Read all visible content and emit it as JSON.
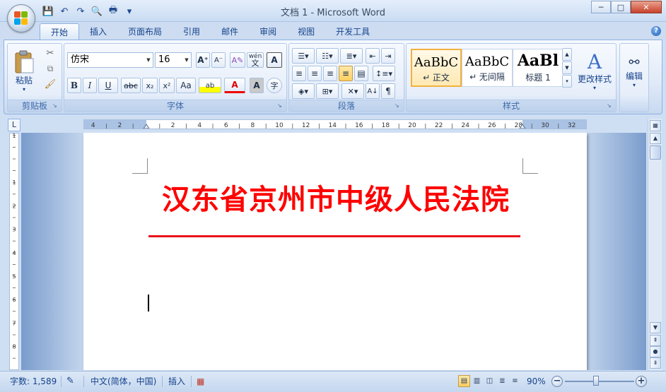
{
  "window": {
    "title": "文档 1 - Microsoft Word",
    "controls": {
      "minimize": "─",
      "maximize": "□",
      "close": "✕"
    }
  },
  "quick_access": [
    {
      "name": "save-icon",
      "glyph": "💾"
    },
    {
      "name": "undo-icon",
      "glyph": "↶"
    },
    {
      "name": "redo-icon",
      "glyph": "↷"
    },
    {
      "name": "print-preview-icon",
      "glyph": "🔍"
    },
    {
      "name": "print-icon",
      "glyph": "🖶"
    },
    {
      "name": "customize-qat-icon",
      "glyph": "▾"
    }
  ],
  "tabs": [
    {
      "label": "开始",
      "active": true
    },
    {
      "label": "插入",
      "active": false
    },
    {
      "label": "页面布局",
      "active": false
    },
    {
      "label": "引用",
      "active": false
    },
    {
      "label": "邮件",
      "active": false
    },
    {
      "label": "审阅",
      "active": false
    },
    {
      "label": "视图",
      "active": false
    },
    {
      "label": "开发工具",
      "active": false
    }
  ],
  "groups": {
    "clipboard": {
      "label": "剪贴板",
      "paste": "粘贴"
    },
    "font": {
      "label": "字体",
      "font_name": "仿宋",
      "font_size": "16",
      "bold": "B",
      "italic": "I",
      "underline": "U",
      "strike": "abc",
      "subscript": "x₂",
      "superscript": "x²",
      "change_case": "Aa",
      "highlight": "ab",
      "font_color": "A",
      "char_shading": "A",
      "enclose": "字",
      "grow": "A⁺",
      "shrink": "A⁻",
      "phonetic": "文",
      "wen": "wén",
      "border_char": "A"
    },
    "paragraph": {
      "label": "段落"
    },
    "styles": {
      "label": "样式",
      "tiles": [
        {
          "sample": "AaBbC",
          "name": "↵ 正文",
          "selected": true
        },
        {
          "sample": "AaBbC",
          "name": "↵ 无间隔",
          "selected": false
        },
        {
          "sample": "AaBl",
          "name": "标题 1",
          "selected": false
        }
      ],
      "change_styles": "更改样式"
    },
    "editing": {
      "label": "编辑"
    }
  },
  "document": {
    "heading": "汉东省京州市中级人民法院",
    "accent_color": "#ff0000"
  },
  "ruler": {
    "labels": [
      "4",
      "2",
      "2",
      "4",
      "6",
      "8",
      "10",
      "12",
      "14",
      "16",
      "18",
      "20",
      "22",
      "24",
      "26",
      "28",
      "30",
      "32"
    ],
    "vertical_labels": [
      "1",
      "1",
      "2",
      "3",
      "4",
      "5",
      "6",
      "7",
      "8"
    ],
    "corner": "L"
  },
  "status": {
    "word_count": "字数: 1,589",
    "language": "中文(简体，中国)",
    "mode": "插入",
    "zoom": "90%",
    "zoom_level_percent": 90
  }
}
